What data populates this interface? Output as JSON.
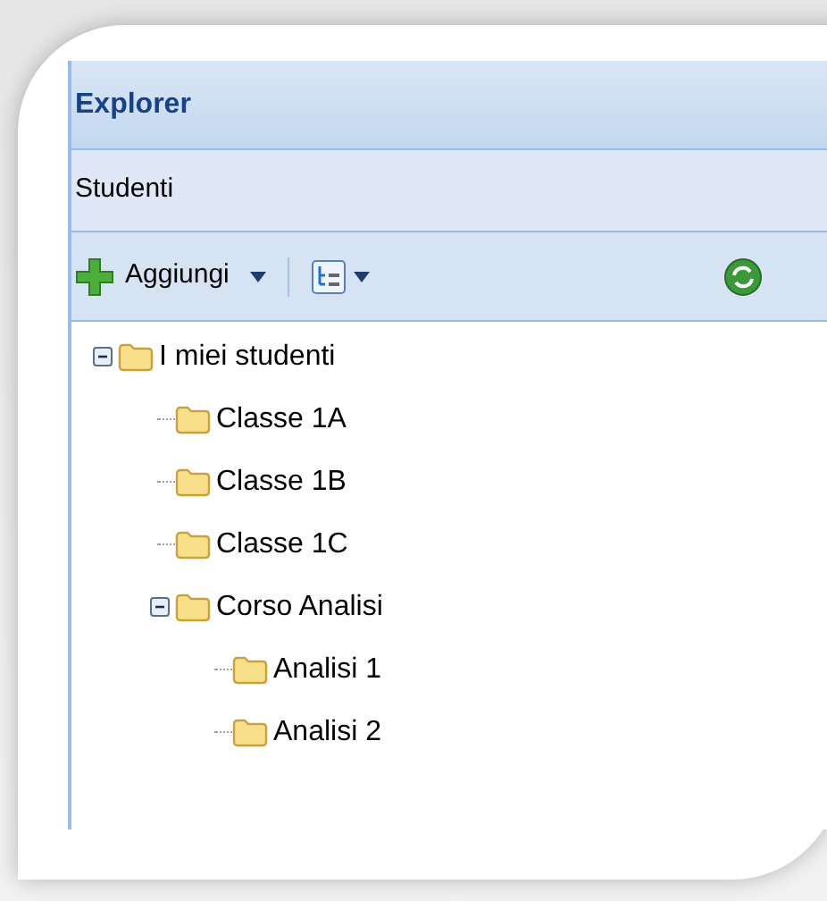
{
  "panel": {
    "title": "Explorer"
  },
  "section": {
    "title": "Studenti"
  },
  "toolbar": {
    "add_button": "Aggiungi"
  },
  "tree": [
    {
      "label": "I miei studenti",
      "expanded": true,
      "children": [
        {
          "label": "Classe 1A"
        },
        {
          "label": "Classe 1B"
        },
        {
          "label": "Classe 1C"
        },
        {
          "label": "Corso Analisi",
          "expanded": true,
          "children": [
            {
              "label": "Analisi 1"
            },
            {
              "label": "Analisi 2"
            }
          ]
        }
      ]
    }
  ]
}
